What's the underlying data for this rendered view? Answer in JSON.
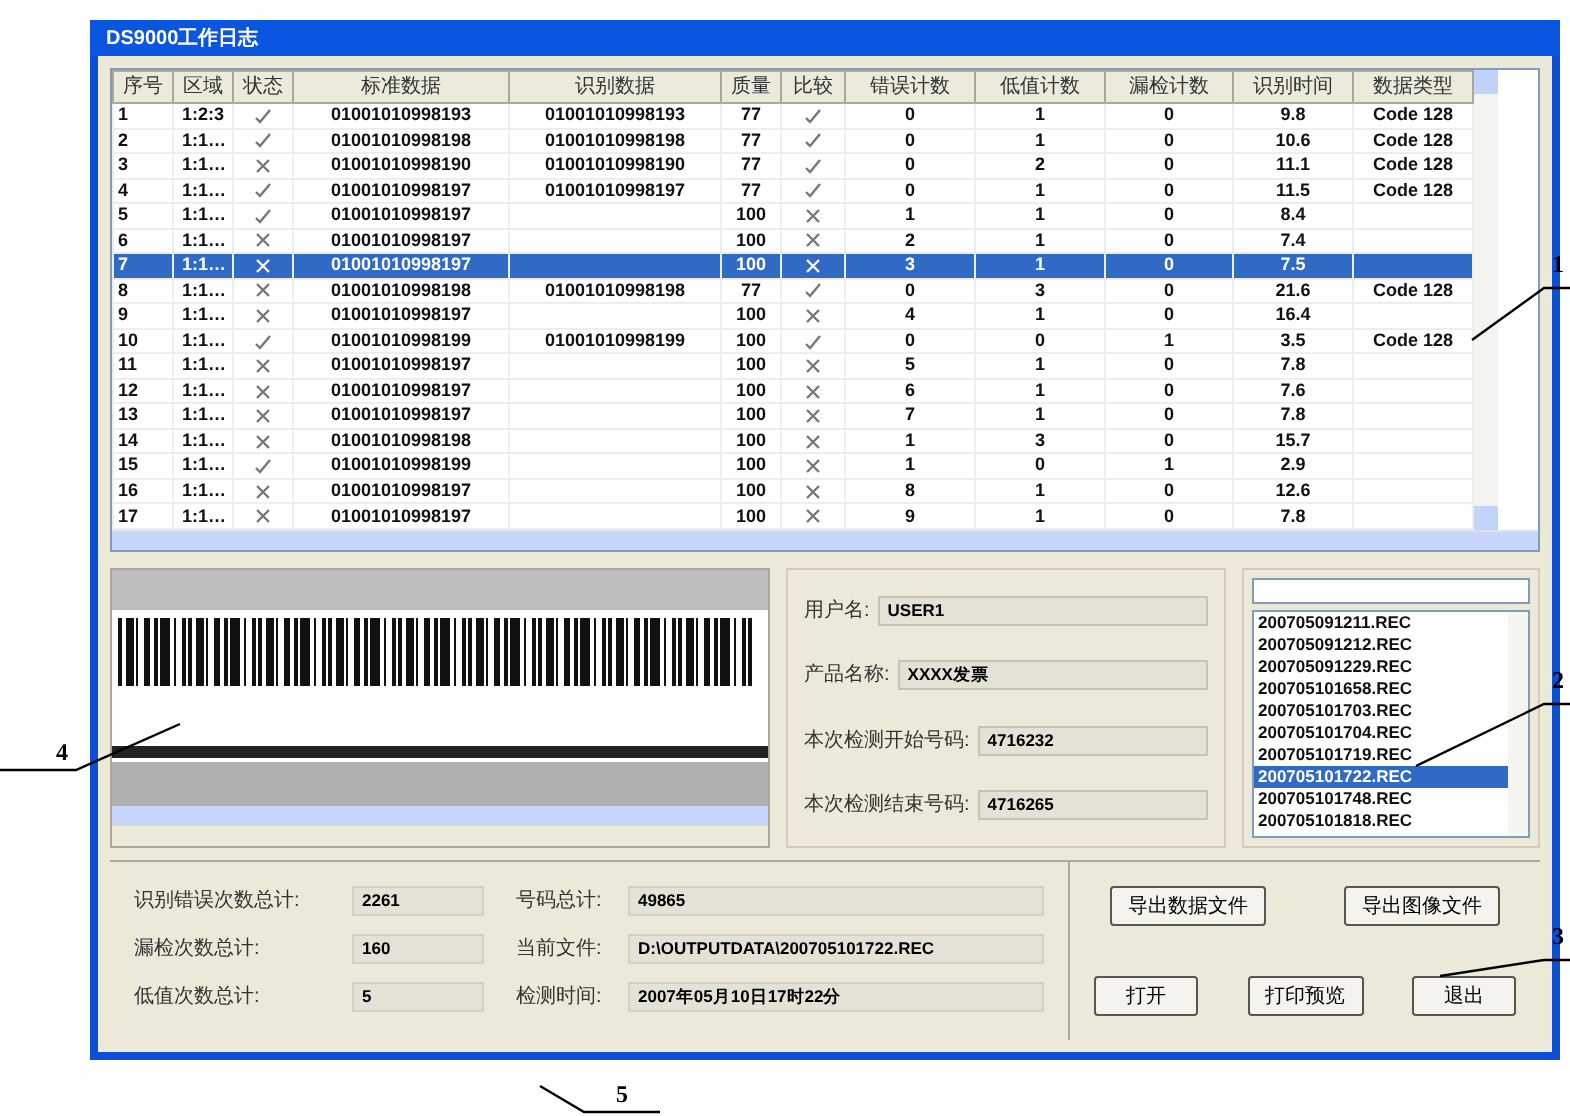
{
  "window": {
    "title": "DS9000工作日志"
  },
  "table": {
    "columns": [
      "序号",
      "区域",
      "状态",
      "标准数据",
      "识别数据",
      "质量",
      "比较",
      "错误计数",
      "低值计数",
      "漏检计数",
      "识别时间",
      "数据类型"
    ],
    "rows": [
      {
        "no": "1",
        "area": "1:2:3",
        "status_ok": true,
        "standard": "01001010998193",
        "recognized": "01001010998193",
        "quality": "77",
        "compare_ok": true,
        "errors": "0",
        "low": "1",
        "missed": "0",
        "time": "9.8",
        "type": "Code 128",
        "selected": false
      },
      {
        "no": "2",
        "area": "1:1…",
        "status_ok": true,
        "standard": "01001010998198",
        "recognized": "01001010998198",
        "quality": "77",
        "compare_ok": true,
        "errors": "0",
        "low": "1",
        "missed": "0",
        "time": "10.6",
        "type": "Code 128",
        "selected": false
      },
      {
        "no": "3",
        "area": "1:1…",
        "status_ok": false,
        "standard": "01001010998190",
        "recognized": "01001010998190",
        "quality": "77",
        "compare_ok": true,
        "errors": "0",
        "low": "2",
        "missed": "0",
        "time": "11.1",
        "type": "Code 128",
        "selected": false
      },
      {
        "no": "4",
        "area": "1:1…",
        "status_ok": true,
        "standard": "01001010998197",
        "recognized": "01001010998197",
        "quality": "77",
        "compare_ok": true,
        "errors": "0",
        "low": "1",
        "missed": "0",
        "time": "11.5",
        "type": "Code 128",
        "selected": false
      },
      {
        "no": "5",
        "area": "1:1…",
        "status_ok": true,
        "standard": "01001010998197",
        "quality": "100",
        "compare_ok": false,
        "errors": "1",
        "low": "1",
        "missed": "0",
        "time": "8.4",
        "selected": false
      },
      {
        "no": "6",
        "area": "1:1…",
        "status_ok": false,
        "standard": "01001010998197",
        "quality": "100",
        "compare_ok": false,
        "errors": "2",
        "low": "1",
        "missed": "0",
        "time": "7.4",
        "selected": false
      },
      {
        "no": "7",
        "area": "1:1…",
        "status_ok": false,
        "standard": "01001010998197",
        "quality": "100",
        "compare_ok": false,
        "errors": "3",
        "low": "1",
        "missed": "0",
        "time": "7.5",
        "selected": true
      },
      {
        "no": "8",
        "area": "1:1…",
        "status_ok": false,
        "standard": "01001010998198",
        "recognized": "01001010998198",
        "quality": "77",
        "compare_ok": true,
        "errors": "0",
        "low": "3",
        "missed": "0",
        "time": "21.6",
        "type": "Code 128",
        "selected": false
      },
      {
        "no": "9",
        "area": "1:1…",
        "status_ok": false,
        "standard": "01001010998197",
        "quality": "100",
        "compare_ok": false,
        "errors": "4",
        "low": "1",
        "missed": "0",
        "time": "16.4",
        "selected": false
      },
      {
        "no": "10",
        "area": "1:1…",
        "status_ok": true,
        "standard": "01001010998199",
        "recognized": "01001010998199",
        "quality": "100",
        "compare_ok": true,
        "errors": "0",
        "low": "0",
        "missed": "1",
        "time": "3.5",
        "type": "Code 128",
        "selected": false
      },
      {
        "no": "11",
        "area": "1:1…",
        "status_ok": false,
        "standard": "01001010998197",
        "quality": "100",
        "compare_ok": false,
        "errors": "5",
        "low": "1",
        "missed": "0",
        "time": "7.8",
        "selected": false
      },
      {
        "no": "12",
        "area": "1:1…",
        "status_ok": false,
        "standard": "01001010998197",
        "quality": "100",
        "compare_ok": false,
        "errors": "6",
        "low": "1",
        "missed": "0",
        "time": "7.6",
        "selected": false
      },
      {
        "no": "13",
        "area": "1:1…",
        "status_ok": false,
        "standard": "01001010998197",
        "quality": "100",
        "compare_ok": false,
        "errors": "7",
        "low": "1",
        "missed": "0",
        "time": "7.8",
        "selected": false
      },
      {
        "no": "14",
        "area": "1:1…",
        "status_ok": false,
        "standard": "01001010998198",
        "quality": "100",
        "compare_ok": false,
        "errors": "1",
        "low": "3",
        "missed": "0",
        "time": "15.7",
        "selected": false
      },
      {
        "no": "15",
        "area": "1:1…",
        "status_ok": true,
        "standard": "01001010998199",
        "quality": "100",
        "compare_ok": false,
        "errors": "1",
        "low": "0",
        "missed": "1",
        "time": "2.9",
        "selected": false
      },
      {
        "no": "16",
        "area": "1:1…",
        "status_ok": false,
        "standard": "01001010998197",
        "quality": "100",
        "compare_ok": false,
        "errors": "8",
        "low": "1",
        "missed": "0",
        "time": "12.6",
        "selected": false
      },
      {
        "no": "17",
        "area": "1:1…",
        "status_ok": false,
        "standard": "01001010998197",
        "quality": "100",
        "compare_ok": false,
        "errors": "9",
        "low": "1",
        "missed": "0",
        "time": "7.8",
        "selected": false
      }
    ]
  },
  "info": [
    {
      "label": "用户名:",
      "value": "USER1"
    },
    {
      "label": "产品名称:",
      "value": "XXXX发票"
    },
    {
      "label": "本次检测开始号码:",
      "value": "4716232"
    },
    {
      "label": "本次检测结束号码:",
      "value": "4716265"
    }
  ],
  "files": [
    {
      "name": "200705091211.REC",
      "selected": false
    },
    {
      "name": "200705091212.REC",
      "selected": false
    },
    {
      "name": "200705091229.REC",
      "selected": false
    },
    {
      "name": "200705101658.REC",
      "selected": false
    },
    {
      "name": "200705101703.REC",
      "selected": false
    },
    {
      "name": "200705101704.REC",
      "selected": false
    },
    {
      "name": "200705101719.REC",
      "selected": false
    },
    {
      "name": "200705101722.REC",
      "selected": true
    },
    {
      "name": "200705101748.REC",
      "selected": false
    },
    {
      "name": "200705101818.REC",
      "selected": false
    }
  ],
  "totals": [
    {
      "label": "识别错误次数总计:",
      "value": "2261"
    },
    {
      "label": "漏检次数总计:",
      "value": "160"
    },
    {
      "label": "低值次数总计:",
      "value": "5"
    }
  ],
  "details": [
    {
      "label": "号码总计:",
      "value": "49865"
    },
    {
      "label": "当前文件:",
      "value": "D:\\OUTPUTDATA\\200705101722.REC"
    },
    {
      "label": "检测时间:",
      "value": "2007年05月10日17时22分"
    }
  ],
  "buttons": {
    "top": [
      "导出数据文件",
      "导出图像文件"
    ],
    "bottom": [
      "打开",
      "打印预览",
      "退出"
    ]
  },
  "callouts": [
    "1",
    "2",
    "3",
    "4",
    "5"
  ]
}
